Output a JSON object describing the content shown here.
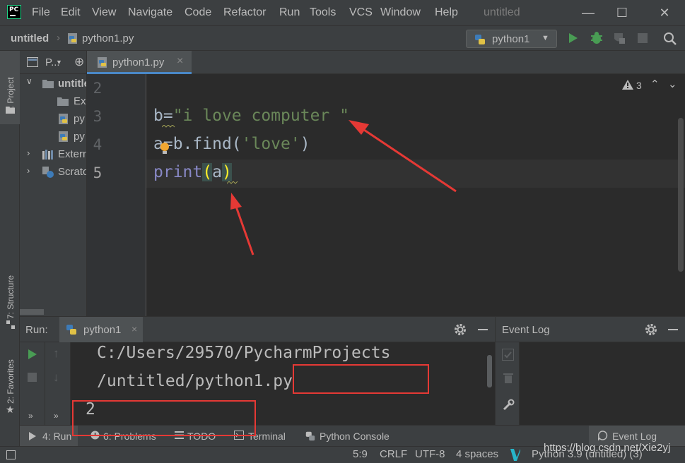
{
  "menu": {
    "logo": "PC",
    "items": [
      "File",
      "Edit",
      "View",
      "Navigate",
      "Code",
      "Refactor",
      "Run",
      "Tools",
      "VCS",
      "Window",
      "Help"
    ],
    "window_title": "untitled"
  },
  "navbar": {
    "project": "untitled",
    "file": "python1.py",
    "run_config": "python1"
  },
  "left_strip": {
    "project_tab": "1: Project",
    "structure_tab": "7: Structure",
    "favorites_tab": "2: Favorites"
  },
  "project_panel": {
    "header": "P...",
    "tree": [
      {
        "label": "untitled"
      },
      {
        "label": "Ex"
      },
      {
        "label": "py"
      },
      {
        "label": "py"
      },
      {
        "label": "Extern"
      },
      {
        "label": "Scrato"
      }
    ]
  },
  "editor": {
    "tab": "python1.py",
    "warning_count": "3",
    "line_numbers": [
      "2",
      "3",
      "4",
      "5"
    ],
    "lines": {
      "l3_var": "b=",
      "l3_str": "\"i love computer \"",
      "l4_a": "a",
      "l4_eq": "=b.find(",
      "l4_str": "'love'",
      "l4_close": ")",
      "l5_print": "print",
      "l5_open": "(",
      "l5_arg": "a",
      "l5_close": ")"
    }
  },
  "run_panel": {
    "title": "Run:",
    "tab": "python1",
    "output": [
      "C:/Users/29570/PycharmProjects",
      "/untitled/python1.py",
      "2"
    ]
  },
  "event_log": {
    "title": "Event Log"
  },
  "bottom_tabs": {
    "run": "4: Run",
    "problems": "6: Problems",
    "todo": "TODO",
    "terminal": "Terminal",
    "python_console": "Python Console",
    "event_log": "Event Log"
  },
  "status_bar": {
    "position": "5:9",
    "line_sep": "CRLF",
    "encoding": "UTF-8",
    "indent": "4 spaces",
    "interpreter": "Python 3.9 (untitled) (3)",
    "watermark": "https://blog.csdn.net/Xie2yj"
  },
  "colors": {
    "annotation": "#e53935",
    "run_green": "#499c54",
    "string_green": "#6a8759"
  }
}
